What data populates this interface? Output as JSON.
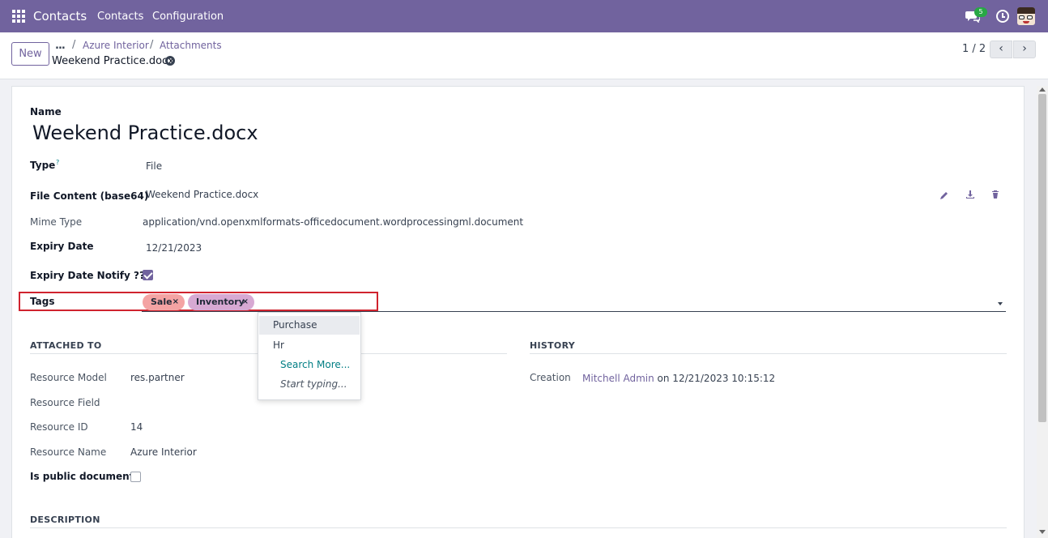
{
  "navbar": {
    "brand": "Contacts",
    "menus": [
      "Contacts",
      "Configuration"
    ],
    "chat_badge": "5"
  },
  "control": {
    "new_label": "New",
    "breadcrumb_dots": "...",
    "breadcrumb": [
      "Azure Interior",
      "Attachments"
    ],
    "current": "Weekend Practice.docx",
    "pager": "1 / 2"
  },
  "form": {
    "name_label": "Name",
    "name_value": "Weekend Practice.docx",
    "type_label": "Type",
    "type_help": "?",
    "type_value": "File",
    "file_content_label": "File Content (base64)",
    "file_content_value": "Weekend Practice.docx",
    "mime_label": "Mime Type",
    "mime_value": "application/vnd.openxmlformats-officedocument.wordprocessingml.document",
    "expiry_label": "Expiry Date",
    "expiry_value": "12/21/2023",
    "expiry_notify_label": "Expiry Date Notify ??",
    "tags_label": "Tags",
    "tags": [
      {
        "label": "Sale",
        "color": "#f4a3a3"
      },
      {
        "label": "Inventory",
        "color": "#d7a9d3"
      }
    ],
    "tag_remove": "×"
  },
  "dropdown": {
    "items": [
      "Purchase",
      "Hr"
    ],
    "search_more": "Search More...",
    "start_typing": "Start typing..."
  },
  "attached": {
    "title": "ATTACHED TO",
    "resource_model_label": "Resource Model",
    "resource_model_value": "res.partner",
    "resource_field_label": "Resource Field",
    "resource_id_label": "Resource ID",
    "resource_id_value": "14",
    "resource_name_label": "Resource Name",
    "resource_name_value": "Azure Interior",
    "public_label": "Is public document"
  },
  "history": {
    "title": "HISTORY",
    "creation_label": "Creation",
    "creation_user": "Mitchell Admin",
    "creation_date": "on 12/21/2023 10:15:12"
  },
  "description": {
    "title": "DESCRIPTION"
  },
  "colors": {
    "brand": "#71639e",
    "accent": "#017e84",
    "highlight": "#d0232e"
  }
}
